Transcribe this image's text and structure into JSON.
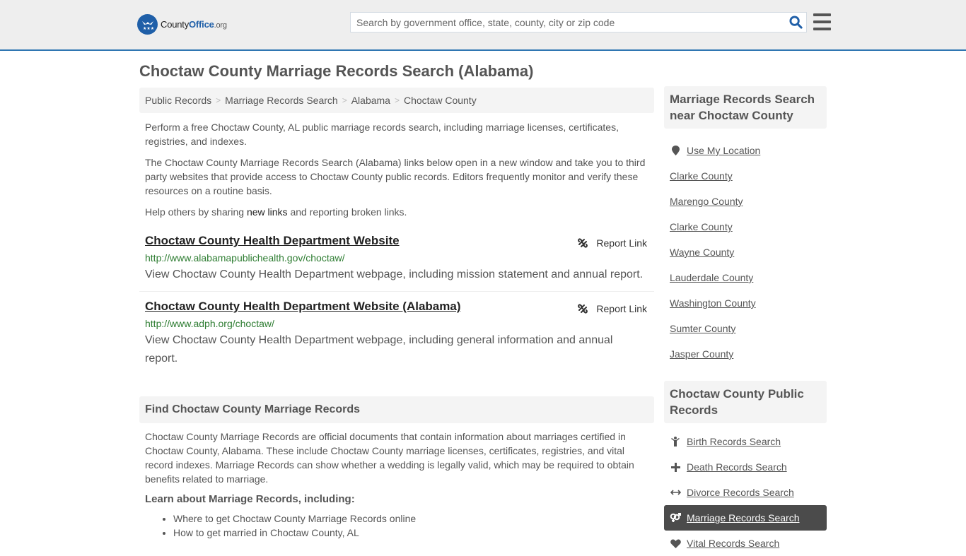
{
  "header": {
    "logo": {
      "name": "County",
      "highlight": "Office",
      "suffix": ".org"
    },
    "search": {
      "placeholder": "Search by government office, state, county, city or zip code",
      "value": ""
    },
    "colors": {
      "accent": "#2f76b2",
      "brand": "#1f5fa8",
      "background": "#eeeeee"
    }
  },
  "page_title": "Choctaw County Marriage Records Search (Alabama)",
  "breadcrumb": [
    {
      "label": "Public Records"
    },
    {
      "label": "Marriage Records Search"
    },
    {
      "label": "Alabama"
    },
    {
      "label": "Choctaw County"
    }
  ],
  "intro": {
    "p1": "Perform a free Choctaw County, AL public marriage records search, including marriage licenses, certificates, registries, and indexes.",
    "p2": "The Choctaw County Marriage Records Search (Alabama) links below open in a new window and take you to third party websites that provide access to Choctaw County public records. Editors frequently monitor and verify these resources on a routine basis.",
    "p3_before": "Help others by sharing ",
    "p3_link": "new links",
    "p3_after": " and reporting broken links."
  },
  "links": [
    {
      "title": "Choctaw County Health Department Website",
      "url": "http://www.alabamapublichealth.gov/choctaw/",
      "description": "View Choctaw County Health Department webpage, including mission statement and annual report.",
      "report_label": "Report Link"
    },
    {
      "title": "Choctaw County Health Department Website (Alabama)",
      "url": "http://www.adph.org/choctaw/",
      "description": "View Choctaw County Health Department webpage, including general information and annual report.",
      "report_label": "Report Link"
    }
  ],
  "find_section": {
    "heading": "Find Choctaw County Marriage Records",
    "body": "Choctaw County Marriage Records are official documents that contain information about marriages certified in Choctaw County, Alabama. These include Choctaw County marriage licenses, certificates, registries, and vital record indexes. Marriage Records can show whether a wedding is legally valid, which may be required to obtain benefits related to marriage.",
    "learn_heading": "Learn about Marriage Records, including:",
    "learn_items": [
      "Where to get Choctaw County Marriage Records online",
      "How to get married in Choctaw County, AL"
    ]
  },
  "sidebar": {
    "nearby_heading": "Marriage Records Search near Choctaw County",
    "use_location": "Use My Location",
    "nearby": [
      "Clarke County",
      "Marengo County",
      "Clarke County",
      "Wayne County",
      "Lauderdale County",
      "Washington County",
      "Sumter County",
      "Jasper County"
    ],
    "records_heading": "Choctaw County Public Records",
    "records": [
      {
        "label": "Birth Records Search",
        "icon": "child-icon",
        "active": false
      },
      {
        "label": "Death Records Search",
        "icon": "plus-icon",
        "active": false
      },
      {
        "label": "Divorce Records Search",
        "icon": "arrows-horizontal-icon",
        "active": false
      },
      {
        "label": "Marriage Records Search",
        "icon": "venus-mars-icon",
        "active": true
      },
      {
        "label": "Vital Records Search",
        "icon": "heartbeat-icon",
        "active": false
      }
    ]
  }
}
